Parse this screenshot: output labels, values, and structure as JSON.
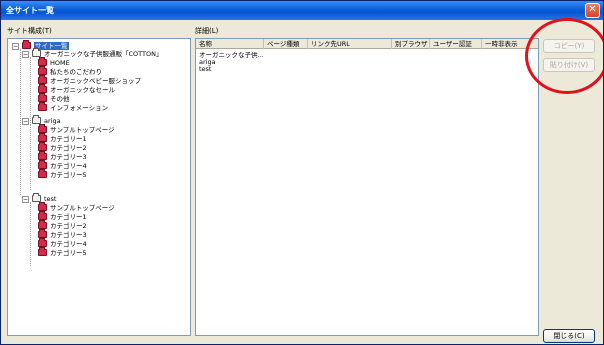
{
  "window": {
    "title": "全サイト一覧",
    "close_glyph": "✕"
  },
  "tree": {
    "label": "サイト構成(T)",
    "root": "サイト一覧",
    "sites": [
      {
        "name": "オーガニックな子供服通販「COTTON」",
        "children": [
          "HOME",
          "私たちのこだわり",
          "オーガニックベビー服ショップ",
          "オーガニックなセール",
          "その他",
          "インフォメーション"
        ]
      },
      {
        "name": "ariga",
        "children": [
          "サンプルトップページ",
          "カテゴリー1",
          "カテゴリー2",
          "カテゴリー3",
          "カテゴリー4",
          "カテゴリー5"
        ]
      },
      {
        "name": "test",
        "children": [
          "サンプルトップページ",
          "カテゴリー1",
          "カテゴリー2",
          "カテゴリー3",
          "カテゴリー4",
          "カテゴリー5"
        ]
      }
    ]
  },
  "details": {
    "label": "詳細(L)",
    "columns": [
      "名称",
      "ページ種類",
      "リンク先URL",
      "別ブラウザ",
      "ユーザー認証",
      "一時非表示"
    ],
    "rows": [
      [
        "オーガニックな子供...",
        "",
        "",
        "",
        "",
        ""
      ],
      [
        "ariga",
        "",
        "",
        "",
        "",
        ""
      ],
      [
        "test",
        "",
        "",
        "",
        "",
        ""
      ]
    ]
  },
  "buttons": {
    "copy": "コピー(Y)",
    "paste": "貼り付け(V)",
    "close": "閉じる(C)"
  },
  "colors": {
    "annotation": "#e3101c",
    "selection": "#316ac5",
    "folder": "#d42a4c"
  }
}
